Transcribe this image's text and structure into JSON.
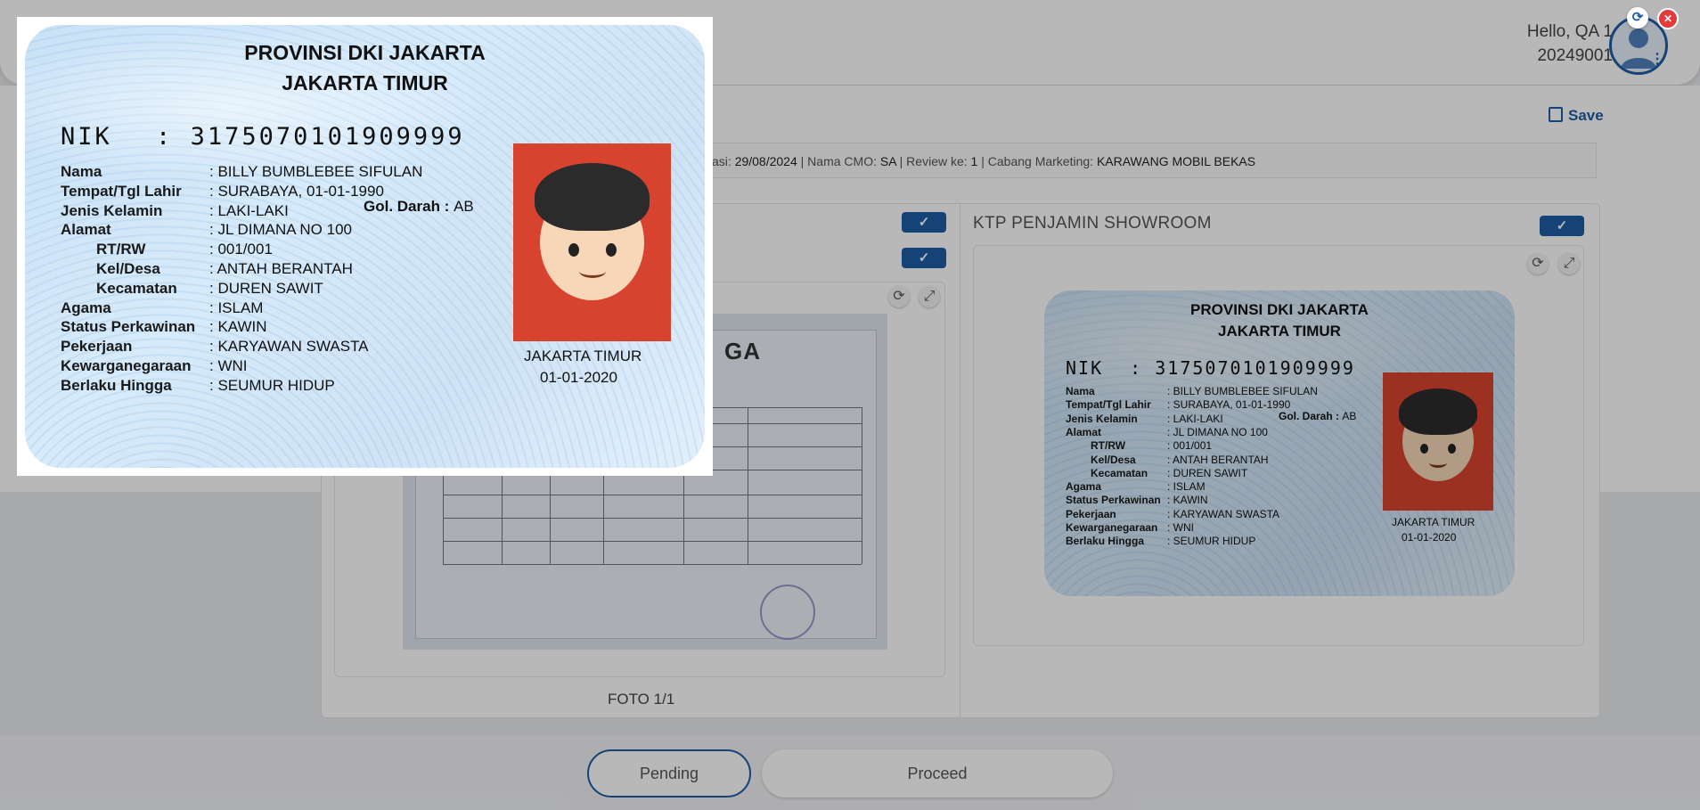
{
  "header": {
    "greeting": "Hello, QA 1",
    "user_id": "20249001",
    "kebab": "⋮"
  },
  "toolbar": {
    "save_label": "Save"
  },
  "infobar": {
    "prefix": "asi:",
    "tanggal": "29/08/2024",
    "cmo_label": "| Nama CMO:",
    "cmo": "SA",
    "review_label": "| Review ke:",
    "review": "1",
    "cabang_label": "| Cabang Marketing:",
    "cabang": "KARAWANG MOBIL BEKAS"
  },
  "doc_left": {
    "kk_title_fragment": "GA",
    "foto_label": "FOTO 1/1"
  },
  "doc_right": {
    "title": "KTP PENJAMIN SHOWROOM"
  },
  "icons": {
    "check": "✓",
    "rotate": "⟳",
    "expand": "⤢",
    "close": "✕"
  },
  "footer": {
    "pending_label": "Pending",
    "proceed_label": "Proceed"
  },
  "ktp": {
    "province": "PROVINSI DKI JAKARTA",
    "city": "JAKARTA TIMUR",
    "nik_label": "NIK",
    "nik_sep": ":",
    "nik": "3175070101909999",
    "fields": [
      {
        "label": "Nama",
        "value": ": BILLY BUMBLEBEE SIFULAN"
      },
      {
        "label": "Tempat/Tgl Lahir",
        "value": ": SURABAYA, 01-01-1990"
      },
      {
        "label": "Jenis Kelamin",
        "value": ": LAKI-LAKI"
      },
      {
        "label": "Alamat",
        "value": ": JL DIMANA NO 100"
      },
      {
        "label": "RT/RW",
        "value": ": 001/001"
      },
      {
        "label": "Kel/Desa",
        "value": ": ANTAH BERANTAH"
      },
      {
        "label": "Kecamatan",
        "value": ": DUREN SAWIT"
      },
      {
        "label": "Agama",
        "value": ": ISLAM"
      },
      {
        "label": "Status Perkawinan",
        "value": ": KAWIN"
      },
      {
        "label": "Pekerjaan",
        "value": ": KARYAWAN SWASTA"
      },
      {
        "label": "Kewarganegaraan",
        "value": ": WNI"
      },
      {
        "label": "Berlaku Hingga",
        "value": ": SEUMUR HIDUP"
      }
    ],
    "goldarah_label": "Gol. Darah :",
    "goldarah": "AB",
    "issue_city": "JAKARTA TIMUR",
    "issue_date": "01-01-2020"
  }
}
